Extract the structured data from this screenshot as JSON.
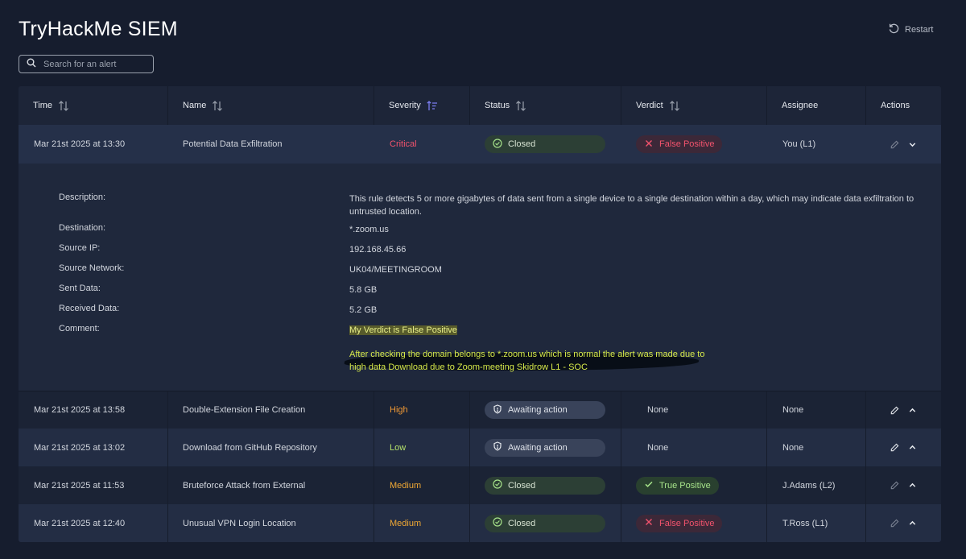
{
  "app": {
    "title": "TryHackMe SIEM",
    "restart_label": "Restart"
  },
  "search": {
    "placeholder": "Search for an alert"
  },
  "columns": {
    "time": "Time",
    "name": "Name",
    "severity": "Severity",
    "status": "Status",
    "verdict": "Verdict",
    "assignee": "Assignee",
    "actions": "Actions"
  },
  "alerts": [
    {
      "time": "Mar 21st 2025 at 13:30",
      "name": "Potential Data Exfiltration",
      "severity": "Critical",
      "status": "Closed",
      "verdict": "False Positive",
      "assignee": "You (L1)"
    },
    {
      "time": "Mar 21st 2025 at 13:58",
      "name": "Double-Extension File Creation",
      "severity": "High",
      "status": "Awaiting action",
      "verdict": "None",
      "assignee": "None"
    },
    {
      "time": "Mar 21st 2025 at 13:02",
      "name": "Download from GitHub Repository",
      "severity": "Low",
      "status": "Awaiting action",
      "verdict": "None",
      "assignee": "None"
    },
    {
      "time": "Mar 21st 2025 at 11:53",
      "name": "Bruteforce Attack from External",
      "severity": "Medium",
      "status": "Closed",
      "verdict": "True Positive",
      "assignee": "J.Adams (L2)"
    },
    {
      "time": "Mar 21st 2025 at 12:40",
      "name": "Unusual VPN Login Location",
      "severity": "Medium",
      "status": "Closed",
      "verdict": "False Positive",
      "assignee": "T.Ross (L1)"
    }
  ],
  "detail": {
    "labels": {
      "description": "Description:",
      "destination": "Destination:",
      "source_ip": "Source IP:",
      "source_network": "Source Network:",
      "sent_data": "Sent Data:",
      "received_data": "Received Data:",
      "comment": "Comment:"
    },
    "description": "This rule detects 5 or more gigabytes of data sent from a single device to a single destination within a day, which may indicate data exfiltration to untrusted location.",
    "destination": "*.zoom.us",
    "source_ip": "192.168.45.66",
    "source_network": "UK04/MEETINGROOM",
    "sent_data": "5.8 GB",
    "received_data": "5.2 GB",
    "comment_line1": "My Verdict is False Positive",
    "comment_line2": "After checking the domain belongs to *.zoom.us which is normal the alert was made due to",
    "comment_line3": "high data Download due to Zoom-meeting   Skidrow L1 - SOC"
  },
  "colors": {
    "background": "#161d2e",
    "critical": "#f2536d",
    "high": "#f29a35",
    "low": "#b5e36b",
    "medium": "#f0a834",
    "closed_pill": "#2c3f35",
    "awaiting_pill": "#39435a",
    "highlight": "#d7ea4a"
  },
  "icons": {
    "restart": "restart-icon",
    "search": "search-icon",
    "sort": "sort-icon",
    "severity_sort": "sort-descending-icon",
    "closed": "check-circle-icon",
    "awaiting": "shield-icon",
    "false_positive": "x-icon",
    "true_positive": "check-icon",
    "edit": "pencil-icon",
    "collapse": "chevron-down-icon",
    "expand": "chevron-up-icon"
  }
}
